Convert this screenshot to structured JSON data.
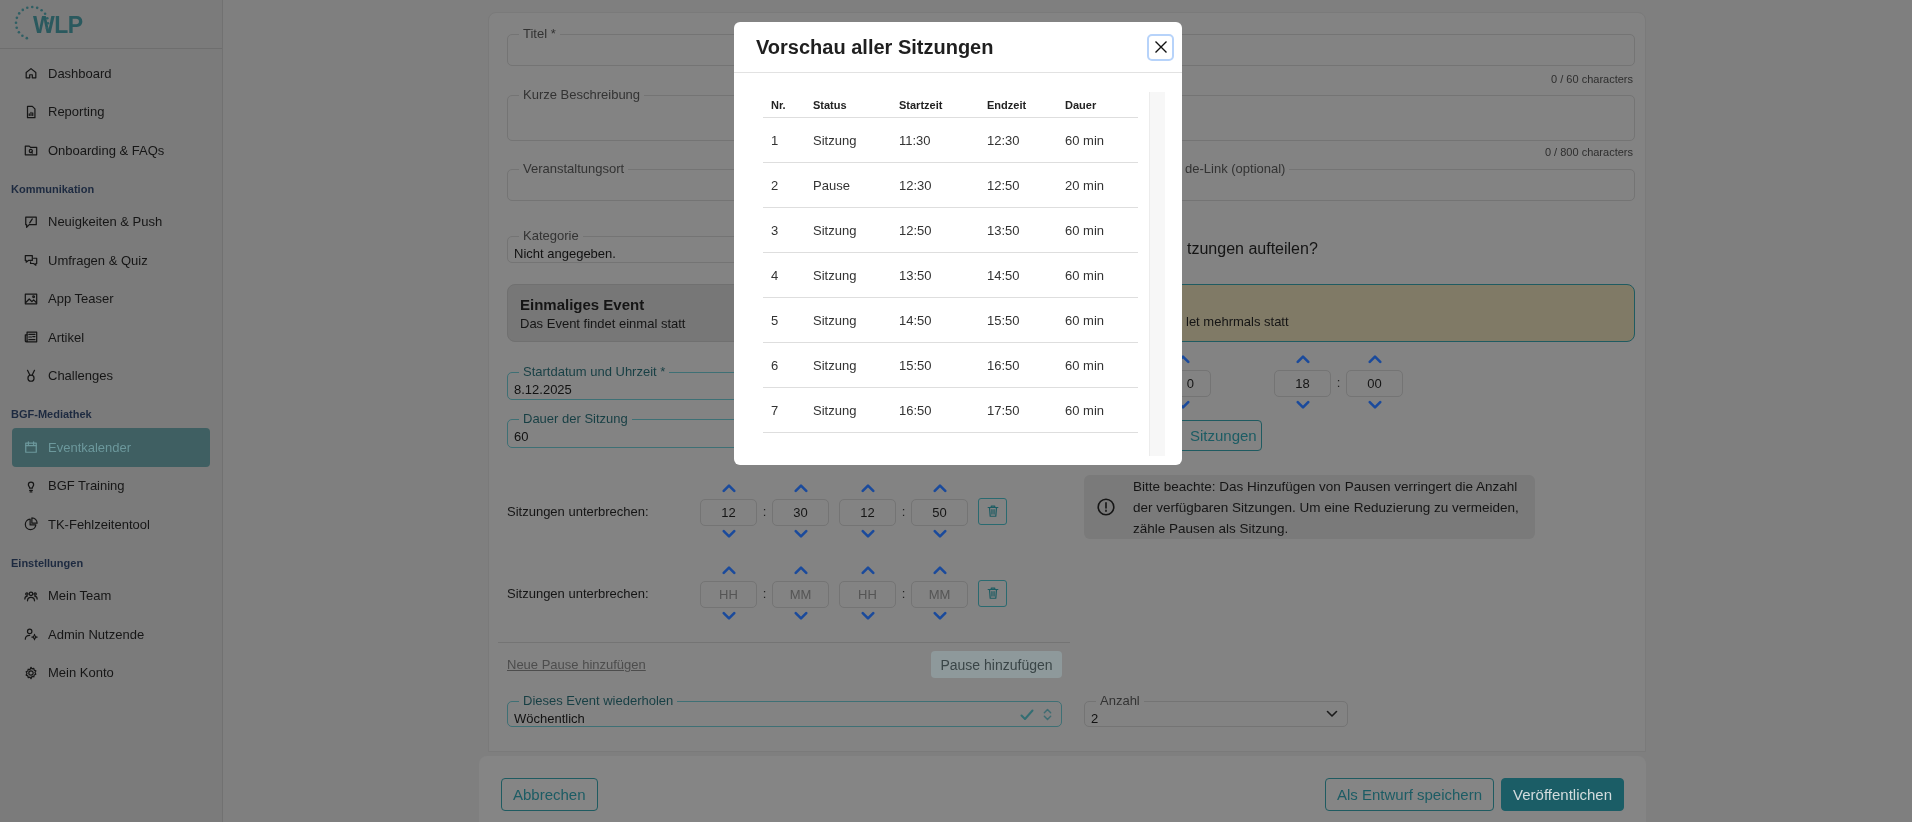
{
  "sidebar": {
    "logo": "WLP",
    "groups": [
      {
        "items": [
          {
            "label": "Dashboard",
            "selected": false
          },
          {
            "label": "Reporting",
            "selected": false
          },
          {
            "label": "Onboarding & FAQs",
            "selected": false
          }
        ]
      },
      {
        "heading": "Kommunikation",
        "items": [
          {
            "label": "Neuigkeiten & Push",
            "selected": false
          },
          {
            "label": "Umfragen & Quiz",
            "selected": false
          },
          {
            "label": "App Teaser",
            "selected": false
          },
          {
            "label": "Artikel",
            "selected": false
          },
          {
            "label": "Challenges",
            "selected": false
          }
        ]
      },
      {
        "heading": "BGF-Mediathek",
        "items": [
          {
            "label": "Eventkalender",
            "selected": true
          },
          {
            "label": "BGF Training",
            "selected": false
          },
          {
            "label": "TK-Fehlzeitentool",
            "selected": false
          }
        ]
      },
      {
        "heading": "Einstellungen",
        "items": [
          {
            "label": "Mein Team",
            "selected": false
          },
          {
            "label": "Admin Nutzende",
            "selected": false
          },
          {
            "label": "Mein Konto",
            "selected": false
          }
        ]
      }
    ]
  },
  "form": {
    "title_field": {
      "label": "Titel *",
      "counter": "0 / 60 characters",
      "highlighted": false
    },
    "description_field": {
      "label": "Kurze Beschreibung",
      "counter": "0 / 800 characters",
      "highlighted": false
    },
    "location_field": {
      "label": "Veranstaltungsort",
      "highlighted": false
    },
    "link_field": {
      "label": "de-Link (optional)",
      "highlighted": false
    },
    "category_field": {
      "label": "Kategorie",
      "value": "Nicht angegeben.",
      "highlighted": false
    },
    "split_question": "tzungen aufteilen?",
    "event_types": [
      {
        "title": "Einmaliges Event",
        "subtitle": "Das Event findet einmal statt",
        "selected": false
      },
      {
        "subtitle": "let mehrmals statt",
        "selected": true
      }
    ],
    "start_field": {
      "label": "Startdatum und Uhrzeit *",
      "value": "8.12.2025",
      "highlighted": true
    },
    "end_time": {
      "partial_value": "0",
      "hour": "18",
      "minute": "00"
    },
    "duration_field": {
      "label": "Dauer der Sitzung",
      "value": "60",
      "highlighted": true
    },
    "preview_button": "Sitzungen",
    "time_separator": ":",
    "breaks": [
      {
        "label": "Sitzungen unterbrechen:",
        "fields": [
          {
            "value": "12"
          },
          {
            "value": "30"
          },
          {
            "value": "12"
          },
          {
            "value": "50"
          }
        ]
      },
      {
        "label": "Sitzungen unterbrechen:",
        "fields": [
          {
            "placeholder": "HH"
          },
          {
            "placeholder": "MM"
          },
          {
            "placeholder": "HH"
          },
          {
            "placeholder": "MM"
          }
        ]
      }
    ],
    "note": "Bitte beachte: Das Hinzufügen von Pausen verringert die Anzahl der verfügbaren Sitzungen. Um eine Reduzierung zu vermeiden, zähle Pausen als Sitzung.",
    "new_break_link": "Neue Pause hinzufügen",
    "add_break_button": {
      "label": "Pause hinzufügen",
      "disabled": true
    },
    "repeat_field": {
      "label": "Dieses Event wiederholen",
      "value": "Wöchentlich",
      "highlighted": true,
      "valid": true
    },
    "count_field": {
      "label": "Anzahl",
      "value": "2",
      "highlighted": false
    }
  },
  "footer": {
    "cancel": "Abbrechen",
    "draft": "Als Entwurf speichern",
    "publish": "Veröffentlichen"
  },
  "modal": {
    "title": "Vorschau aller Sitzungen",
    "columns": [
      "Nr.",
      "Status",
      "Startzeit",
      "Endzeit",
      "Dauer"
    ],
    "rows": [
      [
        "1",
        "Sitzung",
        "11:30",
        "12:30",
        "60 min"
      ],
      [
        "2",
        "Pause",
        "12:30",
        "12:50",
        "20 min"
      ],
      [
        "3",
        "Sitzung",
        "12:50",
        "13:50",
        "60 min"
      ],
      [
        "4",
        "Sitzung",
        "13:50",
        "14:50",
        "60 min"
      ],
      [
        "5",
        "Sitzung",
        "14:50",
        "15:50",
        "60 min"
      ],
      [
        "6",
        "Sitzung",
        "15:50",
        "16:50",
        "60 min"
      ],
      [
        "7",
        "Sitzung",
        "16:50",
        "17:50",
        "60 min"
      ]
    ]
  }
}
